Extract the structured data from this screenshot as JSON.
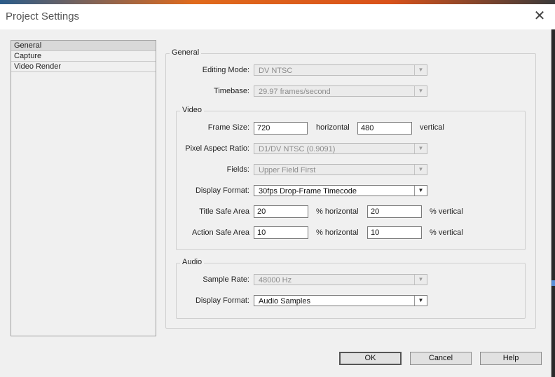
{
  "window": {
    "title": "Project Settings",
    "close_icon": "close-icon"
  },
  "nav": {
    "items": [
      {
        "label": "General",
        "selected": true
      },
      {
        "label": "Capture",
        "selected": false
      },
      {
        "label": "Video Render",
        "selected": false
      }
    ]
  },
  "general": {
    "group_label": "General",
    "editing_mode": {
      "label": "Editing Mode:",
      "value": "DV NTSC",
      "enabled": false
    },
    "timebase": {
      "label": "Timebase:",
      "value": "29.97 frames/second",
      "enabled": false
    }
  },
  "video": {
    "group_label": "Video",
    "frame_size": {
      "label": "Frame Size:",
      "horizontal": "720",
      "horizontal_label": "horizontal",
      "vertical": "480",
      "vertical_label": "vertical"
    },
    "pixel_aspect_ratio": {
      "label": "Pixel Aspect Ratio:",
      "value": "D1/DV NTSC (0.9091)",
      "enabled": false
    },
    "fields": {
      "label": "Fields:",
      "value": "Upper Field First",
      "enabled": false
    },
    "display_format": {
      "label": "Display Format:",
      "value": "30fps Drop-Frame Timecode",
      "enabled": true
    },
    "title_safe": {
      "label": "Title Safe Area",
      "horizontal": "20",
      "horizontal_label": "% horizontal",
      "vertical": "20",
      "vertical_label": "% vertical"
    },
    "action_safe": {
      "label": "Action Safe Area",
      "horizontal": "10",
      "horizontal_label": "% horizontal",
      "vertical": "10",
      "vertical_label": "% vertical"
    }
  },
  "audio": {
    "group_label": "Audio",
    "sample_rate": {
      "label": "Sample Rate:",
      "value": "48000 Hz",
      "enabled": false
    },
    "display_format": {
      "label": "Display Format:",
      "value": "Audio Samples",
      "enabled": true
    }
  },
  "buttons": {
    "ok": "OK",
    "cancel": "Cancel",
    "help": "Help"
  }
}
